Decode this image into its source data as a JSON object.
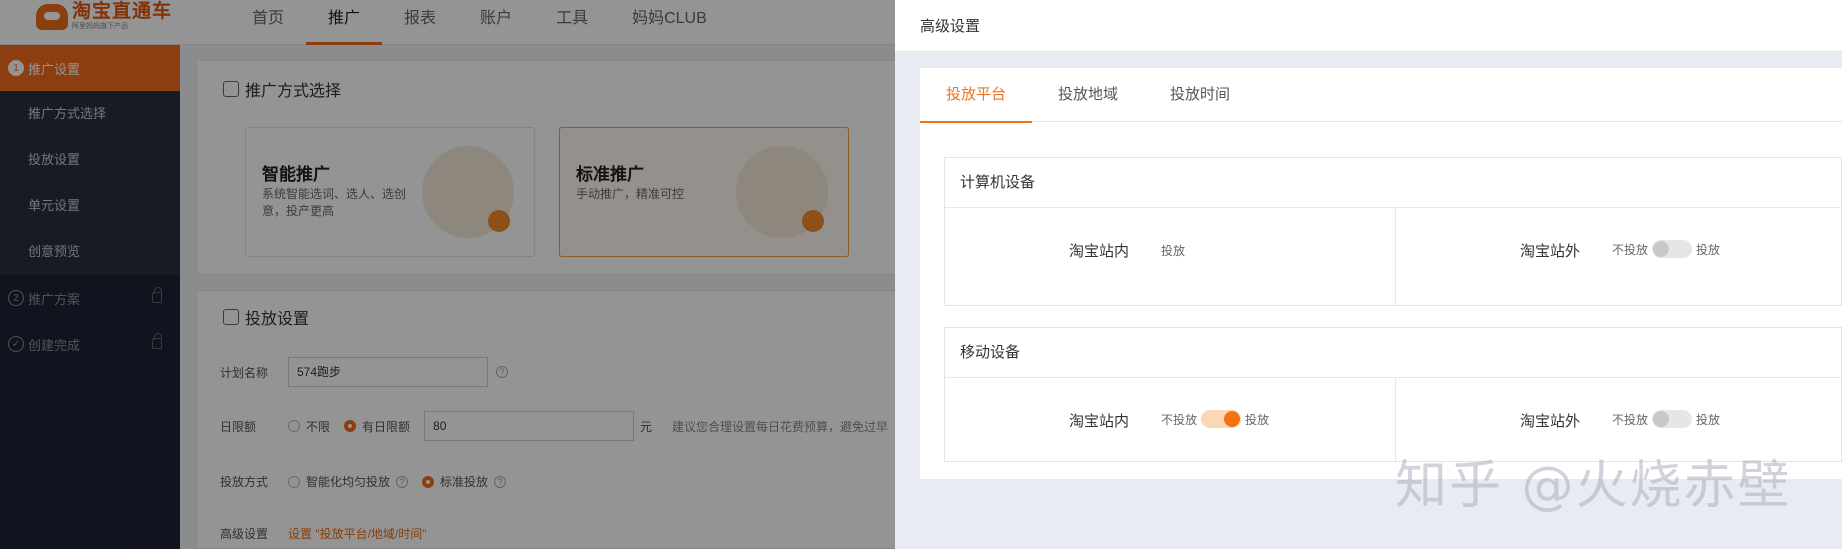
{
  "app": {
    "logo_title": "淘宝直通车",
    "logo_subtitle": "阿里妈妈旗下产品",
    "nav": [
      "首页",
      "推广",
      "报表",
      "账户",
      "工具",
      "妈妈CLUB"
    ],
    "nav_active": "推广"
  },
  "sidebar": {
    "step1": {
      "num": "1",
      "label": "推广设置"
    },
    "sub_items": [
      "推广方式选择",
      "投放设置",
      "单元设置",
      "创意预览"
    ],
    "step2": {
      "num": "2",
      "label": "推广方案"
    },
    "step3": {
      "label": "创建完成"
    }
  },
  "method_panel": {
    "title": "推广方式选择",
    "cards": [
      {
        "title": "智能推广",
        "desc": "系统智能选词、选人、选创意，投产更高"
      },
      {
        "title": "标准推广",
        "desc": "手动推广，精准可控"
      }
    ]
  },
  "delivery_panel": {
    "title": "投放设置",
    "plan_name_label": "计划名称",
    "plan_name_value": "574跑步",
    "daily_limit_label": "日限额",
    "daily_options": [
      "不限",
      "有日限额"
    ],
    "daily_value": "80",
    "daily_unit": "元",
    "daily_tip": "建议您合理设置每日花费预算，避免过早",
    "mode_label": "投放方式",
    "mode_options": [
      "智能化均匀投放",
      "标准投放"
    ],
    "advanced_label": "高级设置",
    "advanced_link": "设置 \"投放平台/地域/时间\""
  },
  "drawer": {
    "title": "高级设置",
    "tabs": [
      "投放平台",
      "投放地域",
      "投放时间"
    ],
    "active_tab": "投放平台",
    "computer": {
      "title": "计算机设备",
      "left": {
        "name": "淘宝站内",
        "state_text": "投放"
      },
      "right": {
        "name": "淘宝站外",
        "off_text": "不投放",
        "on_text": "投放",
        "enabled": false
      }
    },
    "mobile": {
      "title": "移动设备",
      "left": {
        "name": "淘宝站内",
        "off_text": "不投放",
        "on_text": "投放",
        "enabled": true
      },
      "right": {
        "name": "淘宝站外",
        "off_text": "不投放",
        "on_text": "投放",
        "enabled": false
      }
    }
  },
  "watermark": "知乎 @火烧赤壁",
  "colors": {
    "accent": "#f26c1c",
    "sidebar_bg": "#1e2435",
    "drawer_bg": "#e9ebf2"
  }
}
